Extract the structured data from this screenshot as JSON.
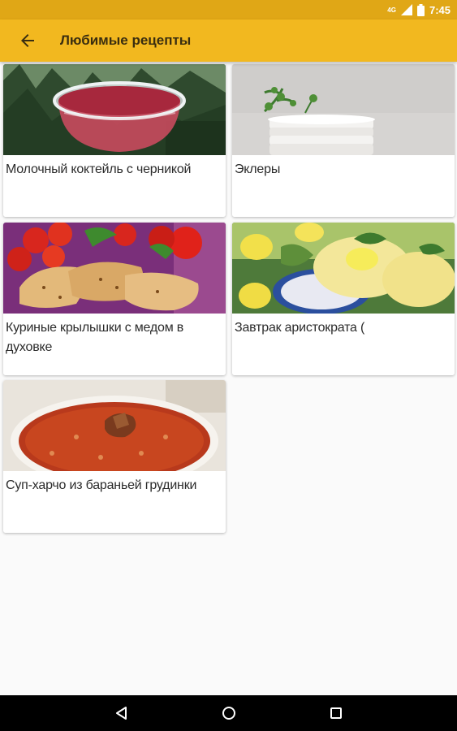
{
  "status_bar": {
    "network": "4G",
    "time": "7:45"
  },
  "app_bar": {
    "title": "Любимые рецепты",
    "back_icon": "arrow-back-icon"
  },
  "recipes": [
    {
      "title": "Молочный коктейль с черникой",
      "image": "berry-milkshake-photo"
    },
    {
      "title": "Эклеры",
      "image": "eclairs-plates-photo"
    },
    {
      "title": "Куриные крылышки с медом в духовке",
      "image": "chicken-wings-photo"
    },
    {
      "title": "Завтрак аристократа (",
      "image": "egg-breakfast-photo"
    },
    {
      "title": "Суп-харчо из бараньей грудинки",
      "image": "kharcho-soup-photo"
    }
  ],
  "colors": {
    "status_bar": "#e0a716",
    "app_bar": "#f2b81f",
    "nav_bar": "#000000"
  }
}
